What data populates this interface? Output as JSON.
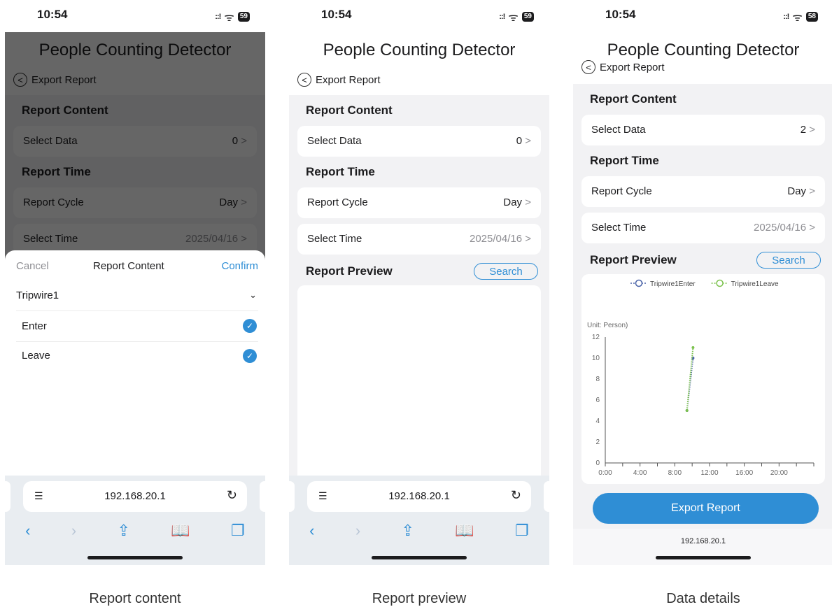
{
  "status": {
    "time": "10:54",
    "signal": "::!",
    "wifi": "ᯤ",
    "battery": "59",
    "battery3": "58"
  },
  "app": {
    "title": "People Counting Detector",
    "back_label": "Export Report"
  },
  "sections": {
    "content": "Report Content",
    "time": "Report Time",
    "preview": "Report Preview"
  },
  "rows": {
    "select_data": "Select Data",
    "report_cycle": "Report Cycle",
    "select_time": "Select Time",
    "select_data_value_1": "0",
    "select_data_value_3": "2",
    "cycle_value": "Day",
    "time_value": "2025/04/16",
    "chevron": ">"
  },
  "search_label": "Search",
  "sheet": {
    "cancel": "Cancel",
    "title": "Report Content",
    "confirm": "Confirm",
    "group": "Tripwire1",
    "items": [
      "Enter",
      "Leave"
    ]
  },
  "browser": {
    "url": "192.168.20.1"
  },
  "export_button": "Export Report",
  "chart_data": {
    "type": "line",
    "ylabel": "Unit: Person)",
    "ylim": [
      0,
      12
    ],
    "yticks": [
      "0",
      "2",
      "4",
      "6",
      "8",
      "10",
      "12"
    ],
    "xticks": [
      "0:00",
      "4:00",
      "8:00",
      "12:00",
      "16:00",
      "20:00"
    ],
    "xlim": [
      0,
      24
    ],
    "legend_position": "top",
    "series": [
      {
        "name": "Tripwire1Enter",
        "color": "#4a63a8",
        "points": [
          [
            9.4,
            5
          ],
          [
            10.1,
            10
          ]
        ]
      },
      {
        "name": "Tripwire1Leave",
        "color": "#7cc24e",
        "points": [
          [
            9.4,
            5
          ],
          [
            10.1,
            11
          ]
        ]
      }
    ]
  },
  "captions": [
    "Report content",
    "Report preview",
    "Data details"
  ]
}
